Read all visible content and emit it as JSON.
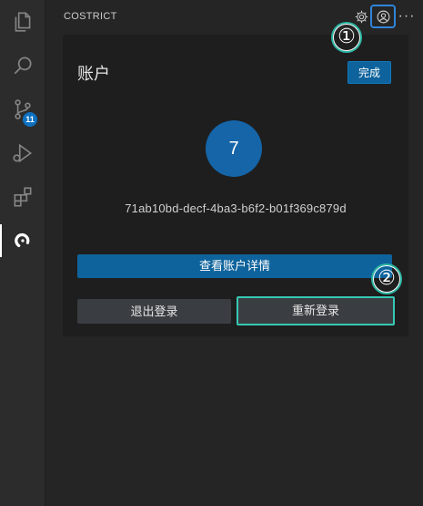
{
  "activity_bar": {
    "items": [
      {
        "icon": "files-icon"
      },
      {
        "icon": "search-icon"
      },
      {
        "icon": "source-control-icon",
        "badge": "11"
      },
      {
        "icon": "run-debug-icon"
      },
      {
        "icon": "extensions-icon"
      },
      {
        "icon": "costrict-icon",
        "active": true
      }
    ]
  },
  "sidebar": {
    "title": "COSTRICT",
    "header_icons": [
      "settings-icon",
      "account-icon",
      "more-icon"
    ]
  },
  "account": {
    "title": "账户",
    "done_label": "完成",
    "avatar_text": "7",
    "user_id": "71ab10bd-decf-4ba3-b6f2-b01f369c879d",
    "details_label": "查看账户详情",
    "logout_label": "退出登录",
    "relogin_label": "重新登录"
  },
  "annotations": {
    "step1": "①",
    "step2": "②"
  },
  "colors": {
    "accent": "#0e639c",
    "avatar": "#1565a8",
    "highlight": "#37c9b5"
  }
}
